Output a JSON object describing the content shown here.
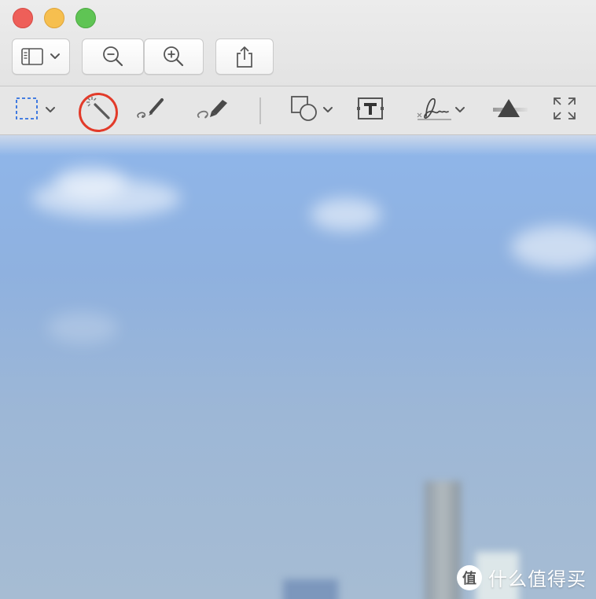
{
  "window": {
    "traffic_lights": [
      "close",
      "minimize",
      "zoom"
    ]
  },
  "toolbar": {
    "buttons": [
      {
        "name": "sidebar-toggle",
        "icon": "sidebar-icon"
      },
      {
        "name": "zoom-out",
        "icon": "zoom-out-icon"
      },
      {
        "name": "zoom-in",
        "icon": "zoom-in-icon"
      },
      {
        "name": "share",
        "icon": "share-icon"
      }
    ]
  },
  "markup_toolbar": {
    "tools": [
      {
        "name": "rectangular-selection",
        "icon": "selection-icon",
        "has_menu": true
      },
      {
        "name": "instant-alpha",
        "icon": "magic-wand-icon",
        "highlighted": true
      },
      {
        "name": "sketch",
        "icon": "sketch-pen-icon"
      },
      {
        "name": "draw",
        "icon": "draw-pen-icon"
      },
      {
        "name": "shapes",
        "icon": "shapes-icon",
        "has_menu": true
      },
      {
        "name": "text",
        "icon": "text-box-icon"
      },
      {
        "name": "sign",
        "icon": "signature-icon",
        "has_menu": true
      },
      {
        "name": "adjust-color",
        "icon": "prism-icon"
      },
      {
        "name": "adjust-size",
        "icon": "resize-icon"
      }
    ],
    "highlight_color": "#e23b2a",
    "selection_color": "#2f6fe0"
  },
  "watermark": {
    "text": "什么值得买",
    "logo_glyph": "值"
  }
}
